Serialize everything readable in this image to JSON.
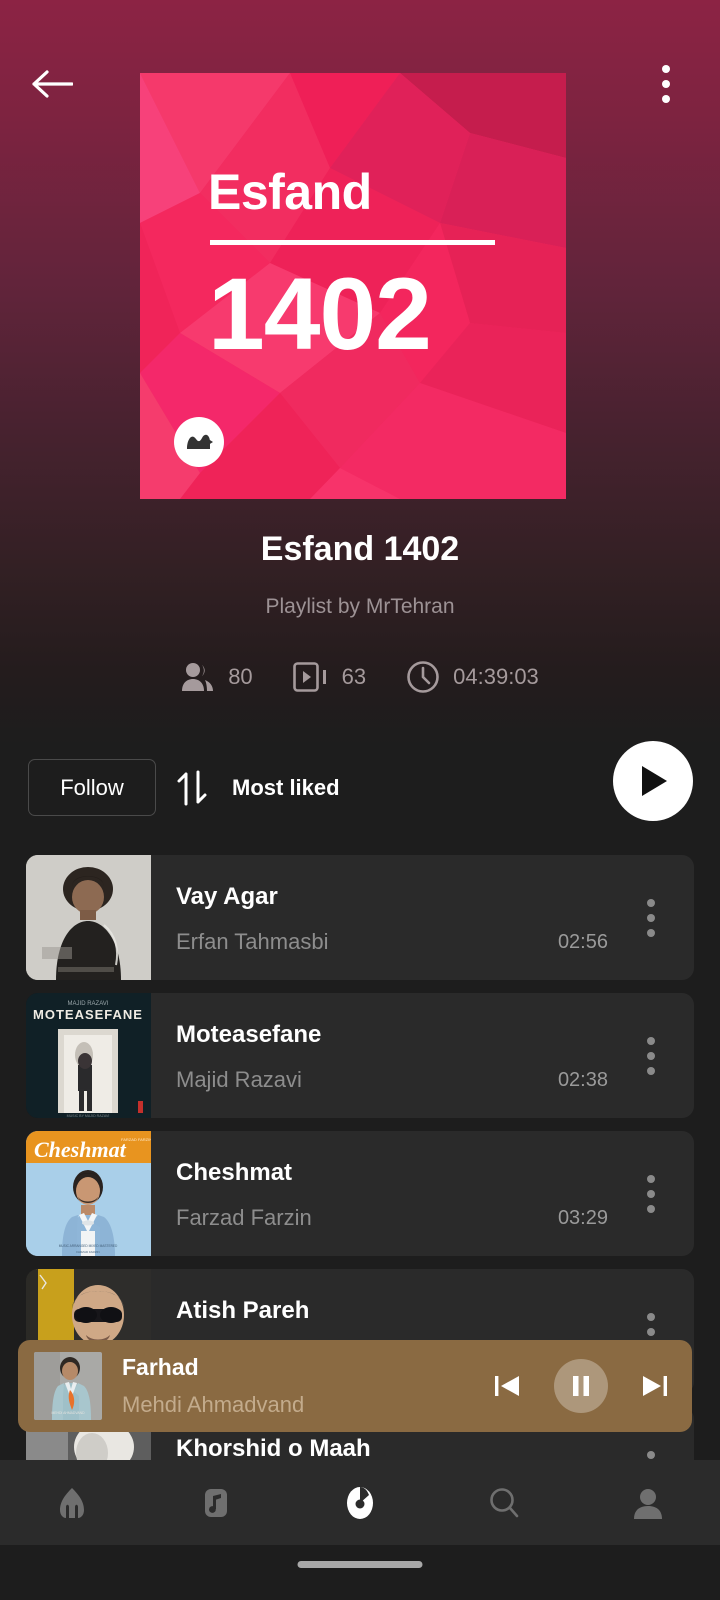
{
  "theme": {
    "hero_top": "#8c2344",
    "page_bg": "#1d1d1d",
    "row_bg": "#2a2a2a",
    "cover_pink": "#f4275f",
    "mini_player_bg": "#8a6a42",
    "accent_white": "#ffffff"
  },
  "topbar": {
    "back_icon": "arrow-left-icon",
    "overflow_icon": "more-vertical-icon"
  },
  "cover": {
    "line1": "Esfand",
    "line2": "1402",
    "badge_icon": "mrtehran-logo-icon"
  },
  "header": {
    "title": "Esfand 1402",
    "subtitle": "Playlist by MrTehran",
    "stats": [
      {
        "icon": "people-icon",
        "value": "80"
      },
      {
        "icon": "tracks-icon",
        "value": "63"
      },
      {
        "icon": "clock-icon",
        "value": "04:39:03"
      }
    ]
  },
  "actions": {
    "follow_label": "Follow",
    "sort_icon": "sort-arrows-icon",
    "sort_label": "Most liked",
    "play_icon": "play-icon"
  },
  "tracks": [
    {
      "title": "Vay Agar",
      "artist": "Erfan Tahmasbi",
      "duration": "02:56"
    },
    {
      "title": "Moteasefane",
      "artist": "Majid Razavi",
      "duration": "02:38"
    },
    {
      "title": "Cheshmat",
      "artist": "Farzad Farzin",
      "duration": "03:29"
    },
    {
      "title": "Atish Pareh",
      "artist": "",
      "duration": ""
    },
    {
      "title": "Khorshid o Maah",
      "artist": "",
      "duration": ""
    }
  ],
  "miniplayer": {
    "title": "Farhad",
    "artist": "Mehdi Ahmadvand",
    "prev_icon": "skip-previous-icon",
    "pause_icon": "pause-icon",
    "next_icon": "skip-next-icon"
  },
  "bottomnav": [
    {
      "icon": "home-icon",
      "active": false
    },
    {
      "icon": "music-icon",
      "active": false
    },
    {
      "icon": "playlist-icon",
      "active": true
    },
    {
      "icon": "search-icon",
      "active": false
    },
    {
      "icon": "profile-icon",
      "active": false
    }
  ]
}
